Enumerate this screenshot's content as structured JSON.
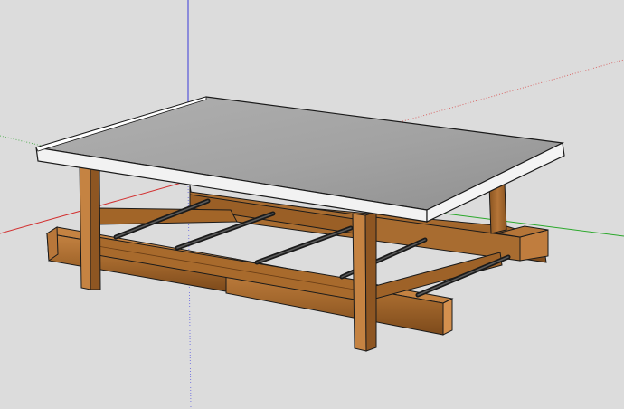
{
  "viewport": {
    "background_color": "#dcdcdc"
  },
  "axes": {
    "red": "#d22a2a",
    "green": "#2aa82a",
    "blue": "#2a2ad2"
  },
  "model": {
    "tabletop_color": "#e8e8e8",
    "tabletop_shadow": "#9a9a9a",
    "wood_color": "#a0642a",
    "wood_light": "#c27d3e",
    "wood_dark": "#6b3e16",
    "rod_color": "#1e1e1e"
  }
}
